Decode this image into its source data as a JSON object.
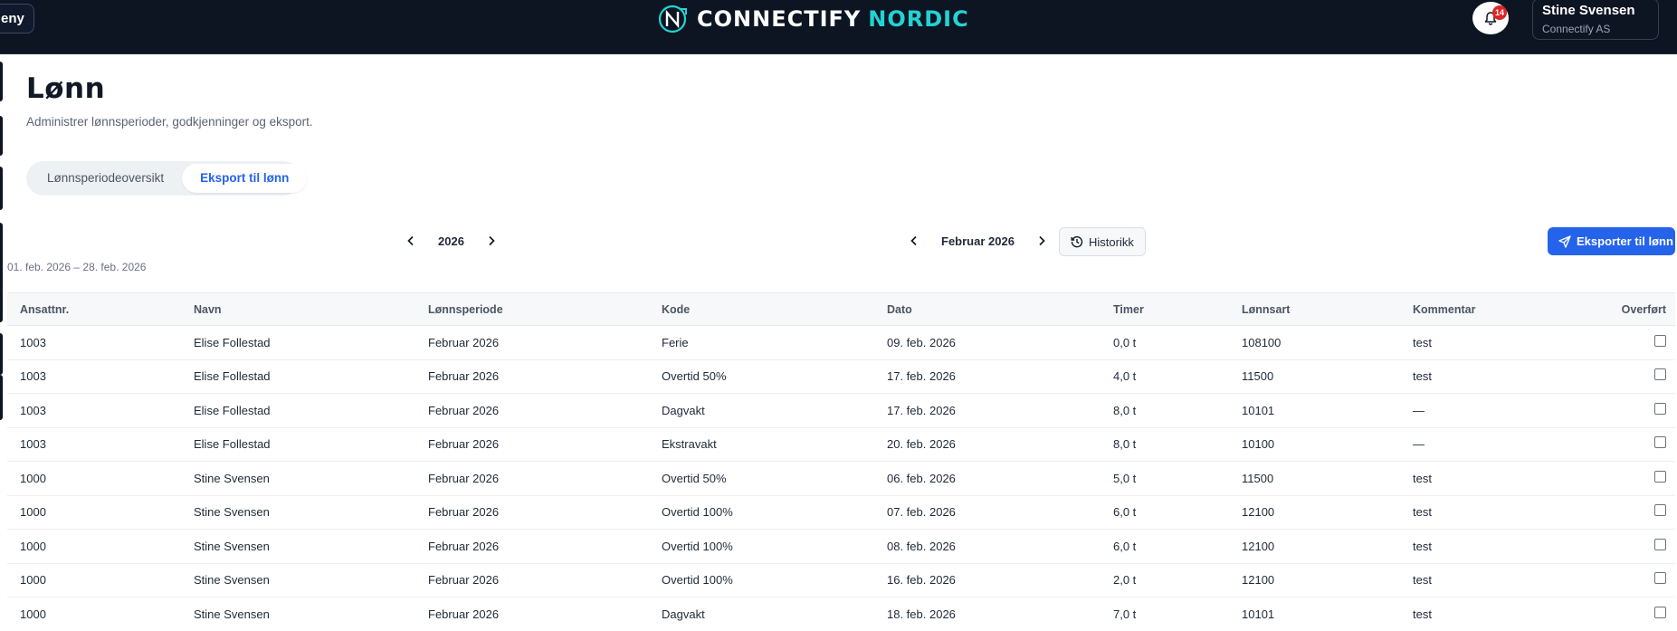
{
  "header": {
    "menu_label": "eny",
    "brand_a": "CONNECTIFY",
    "brand_b": "NORDIC",
    "notification_count": "14",
    "user_name": "Stine Svensen",
    "user_org": "Connectify AS"
  },
  "page": {
    "title": "Lønn",
    "subtitle": "Administrer lønnsperioder, godkjenninger og eksport."
  },
  "tabs": [
    {
      "label": "Lønnsperiodeoversikt",
      "active": false
    },
    {
      "label": "Eksport til lønn",
      "active": true
    }
  ],
  "controls": {
    "year": "2026",
    "month": "Februar 2026",
    "history_label": "Historikk",
    "export_label": "Eksporter til lønn",
    "date_range": "01. feb. 2026 – 28. feb. 2026"
  },
  "table": {
    "columns": [
      "Ansattnr.",
      "Navn",
      "Lønnsperiode",
      "Kode",
      "Dato",
      "Timer",
      "Lønnsart",
      "Kommentar",
      "Overført"
    ],
    "rows": [
      [
        "1003",
        "Elise Follestad",
        "Februar 2026",
        "Ferie",
        "09. feb. 2026",
        "0,0 t",
        "108100",
        "test"
      ],
      [
        "1003",
        "Elise Follestad",
        "Februar 2026",
        "Overtid 50%",
        "17. feb. 2026",
        "4,0 t",
        "11500",
        "test"
      ],
      [
        "1003",
        "Elise Follestad",
        "Februar 2026",
        "Dagvakt",
        "17. feb. 2026",
        "8,0 t",
        "10101",
        "—"
      ],
      [
        "1003",
        "Elise Follestad",
        "Februar 2026",
        "Ekstravakt",
        "20. feb. 2026",
        "8,0 t",
        "10100",
        "—"
      ],
      [
        "1000",
        "Stine Svensen",
        "Februar 2026",
        "Overtid 50%",
        "06. feb. 2026",
        "5,0 t",
        "11500",
        "test"
      ],
      [
        "1000",
        "Stine Svensen",
        "Februar 2026",
        "Overtid 100%",
        "07. feb. 2026",
        "6,0 t",
        "12100",
        "test"
      ],
      [
        "1000",
        "Stine Svensen",
        "Februar 2026",
        "Overtid 100%",
        "08. feb. 2026",
        "6,0 t",
        "12100",
        "test"
      ],
      [
        "1000",
        "Stine Svensen",
        "Februar 2026",
        "Overtid 100%",
        "16. feb. 2026",
        "2,0 t",
        "12100",
        "test"
      ],
      [
        "1000",
        "Stine Svensen",
        "Februar 2026",
        "Dagvakt",
        "18. feb. 2026",
        "7,0 t",
        "10101",
        "test"
      ]
    ]
  },
  "colors": {
    "header_bg": "#0d1422",
    "accent": "#2563eb",
    "brand_cyan": "#22d3d3",
    "badge": "#dc2626"
  }
}
